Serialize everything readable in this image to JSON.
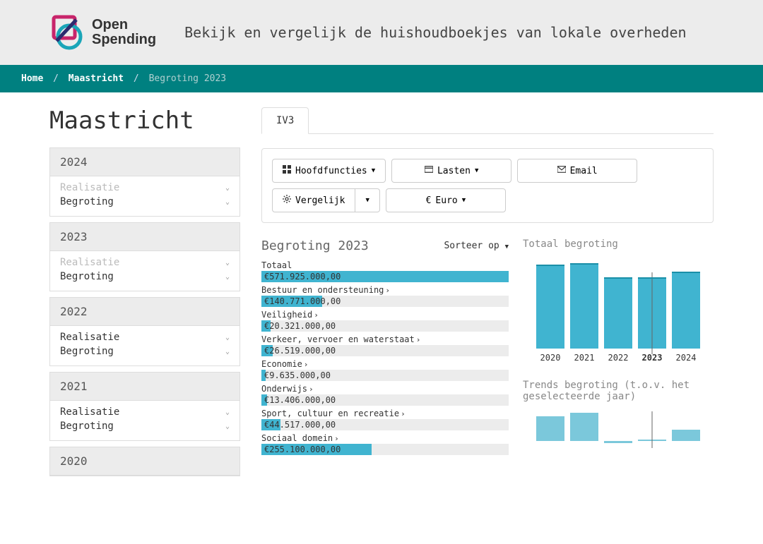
{
  "header": {
    "brand1": "Open",
    "brand2": "Spending",
    "tagline": "Bekijk en vergelijk de huishoudboekjes van lokale overheden"
  },
  "breadcrumb": {
    "home": "Home",
    "gov": "Maastricht",
    "current": "Begroting 2023"
  },
  "page_title": "Maastricht",
  "years": [
    {
      "year": "2024",
      "items": [
        {
          "label": "Realisatie",
          "disabled": true
        },
        {
          "label": "Begroting",
          "disabled": false
        }
      ]
    },
    {
      "year": "2023",
      "items": [
        {
          "label": "Realisatie",
          "disabled": true
        },
        {
          "label": "Begroting",
          "disabled": false
        }
      ]
    },
    {
      "year": "2022",
      "items": [
        {
          "label": "Realisatie",
          "disabled": false
        },
        {
          "label": "Begroting",
          "disabled": false
        }
      ]
    },
    {
      "year": "2021",
      "items": [
        {
          "label": "Realisatie",
          "disabled": false
        },
        {
          "label": "Begroting",
          "disabled": false
        }
      ]
    },
    {
      "year": "2020",
      "items": []
    }
  ],
  "tabs": {
    "iv3": "IV3"
  },
  "toolbar": {
    "hoofdfuncties": "Hoofdfuncties",
    "lasten": "Lasten",
    "email": "Email",
    "vergelijk": "Vergelijk",
    "euro": "Euro"
  },
  "section": {
    "title": "Begroting 2023",
    "sort": "Sorteer op"
  },
  "bars": {
    "total_label": "Totaal",
    "total_value": "€571.925.000,00",
    "rows": [
      {
        "label": "Bestuur en ondersteuning",
        "value": "€140.771.000,00",
        "pct": 24.6
      },
      {
        "label": "Veiligheid",
        "value": "€20.321.000,00",
        "pct": 3.6
      },
      {
        "label": "Verkeer, vervoer en waterstaat",
        "value": "€26.519.000,00",
        "pct": 4.6
      },
      {
        "label": "Economie",
        "value": "€9.635.000,00",
        "pct": 1.7
      },
      {
        "label": "Onderwijs",
        "value": "€13.406.000,00",
        "pct": 2.3
      },
      {
        "label": "Sport, cultuur en recreatie",
        "value": "€44.517.000,00",
        "pct": 7.8
      },
      {
        "label": "Sociaal domein",
        "value": "€255.100.000,00",
        "pct": 44.6
      }
    ]
  },
  "chart1_title": "Totaal begroting",
  "chart2_title": "Trends begroting (t.o.v. het geselecteerde jaar)",
  "chart_data": [
    {
      "type": "bar",
      "title": "Totaal begroting",
      "categories": [
        "2020",
        "2021",
        "2022",
        "2023",
        "2024"
      ],
      "values": [
        120,
        122,
        102,
        102,
        110
      ],
      "selected": "2023",
      "ylabel": "",
      "xlabel": ""
    },
    {
      "type": "bar",
      "title": "Trends begroting (t.o.v. het geselecteerde jaar)",
      "categories": [
        "2020",
        "2021",
        "2022",
        "2023",
        "2024"
      ],
      "values": [
        55,
        62,
        -5,
        0,
        25
      ],
      "selected": "2023",
      "baseline": 0
    }
  ]
}
